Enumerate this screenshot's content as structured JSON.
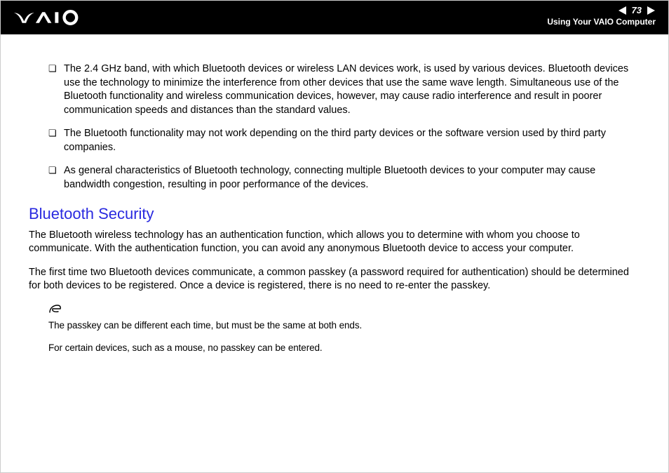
{
  "header": {
    "page_number": "73",
    "subtitle": "Using Your VAIO Computer"
  },
  "bullets": [
    "The 2.4 GHz band, with which Bluetooth devices or wireless LAN devices work, is used by various devices. Bluetooth devices use the technology to minimize the interference from other devices that use the same wave length. Simultaneous use of the Bluetooth functionality and wireless communication devices, however, may cause radio interference and result in poorer communication speeds and distances than the standard values.",
    "The Bluetooth functionality may not work depending on the third party devices or the software version used by third party companies.",
    "As general characteristics of Bluetooth technology, connecting multiple Bluetooth devices to your computer may cause bandwidth congestion, resulting in poor performance of the devices."
  ],
  "section_heading": "Bluetooth Security",
  "paragraphs": [
    "The Bluetooth wireless technology has an authentication function, which allows you to determine with whom you choose to communicate. With the authentication function, you can avoid any anonymous Bluetooth device to access your computer.",
    "The first time two Bluetooth devices communicate, a common passkey (a password required for authentication) should be determined for both devices to be registered. Once a device is registered, there is no need to re-enter the passkey."
  ],
  "notes": [
    "The passkey can be different each time, but must be the same at both ends.",
    "For certain devices, such as a mouse, no passkey can be entered."
  ]
}
